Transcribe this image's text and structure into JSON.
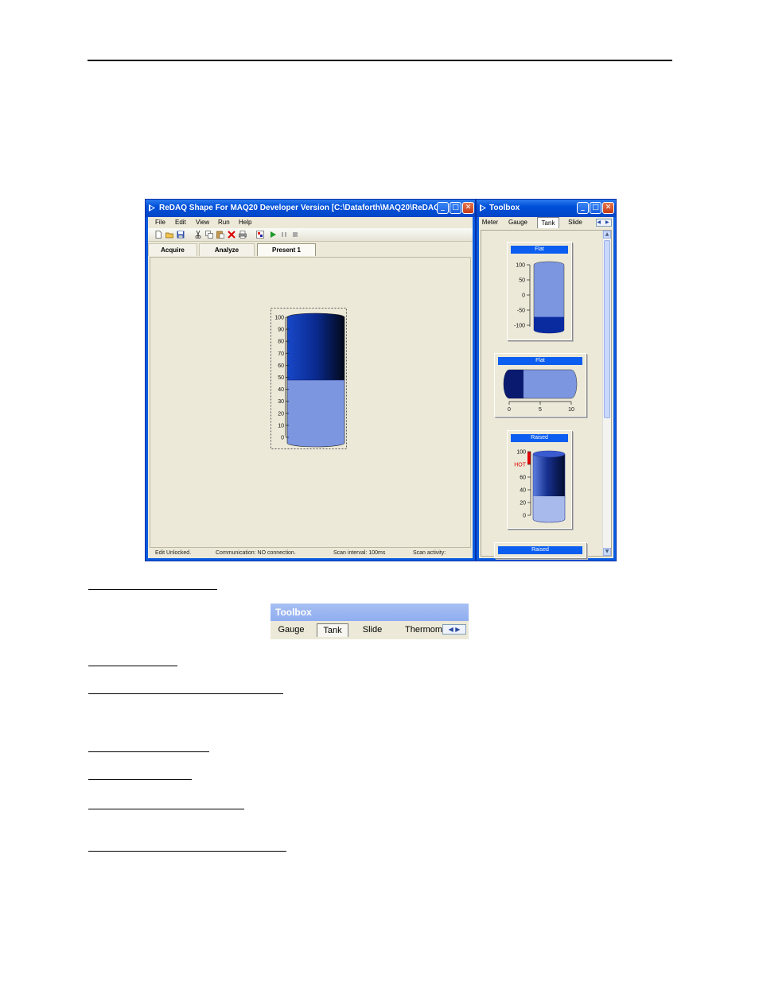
{
  "main_window": {
    "title": "ReDAQ Shape For MAQ20 Developer Version [C:\\Dataforth\\MAQ20\\ReDAQ Shap...",
    "menu": [
      "File",
      "Edit",
      "View",
      "Run",
      "Help"
    ],
    "tabs": [
      {
        "label": "Acquire",
        "active": false
      },
      {
        "label": "Analyze",
        "active": false
      },
      {
        "label": "Present 1",
        "active": true
      }
    ],
    "tank": {
      "scale": [
        "100",
        "90",
        "80",
        "70",
        "60",
        "50",
        "40",
        "30",
        "20",
        "10",
        "0"
      ],
      "level": 50,
      "range": [
        0,
        100
      ]
    },
    "status": {
      "edit": "Edit Unlocked.",
      "communication": "Communication: NO connection.",
      "scan_interval": "Scan interval: 100ms",
      "scan_activity": "Scan activity:"
    }
  },
  "toolbox_window": {
    "title": "Toolbox",
    "tabs": [
      "Meter",
      "Gauge",
      "Tank",
      "Slide"
    ],
    "active_tab": "Tank",
    "items": [
      {
        "label": "Flat",
        "scale": [
          "100",
          "50",
          "0",
          "-50",
          "-100"
        ],
        "level": -60
      },
      {
        "label": "Flat",
        "scale": [
          "0",
          "5",
          "10"
        ],
        "level": 2.3
      },
      {
        "label": "Raised",
        "scale": [
          "100",
          "HOT",
          "60",
          "40",
          "20",
          "0"
        ],
        "level": 35
      },
      {
        "label": "Raised"
      }
    ]
  },
  "toolbox_snippet": {
    "title": "Toolbox",
    "tabs": [
      "Gauge",
      "Tank",
      "Slide",
      "Thermom"
    ],
    "active_tab": "Tank"
  },
  "colors": {
    "xp_title_blue": "#0050d8",
    "tank_dark": "#0a1a6e",
    "tank_light": "#7c96e0",
    "label_blue": "#0b5ef0",
    "alarm_red": "#e00000"
  }
}
